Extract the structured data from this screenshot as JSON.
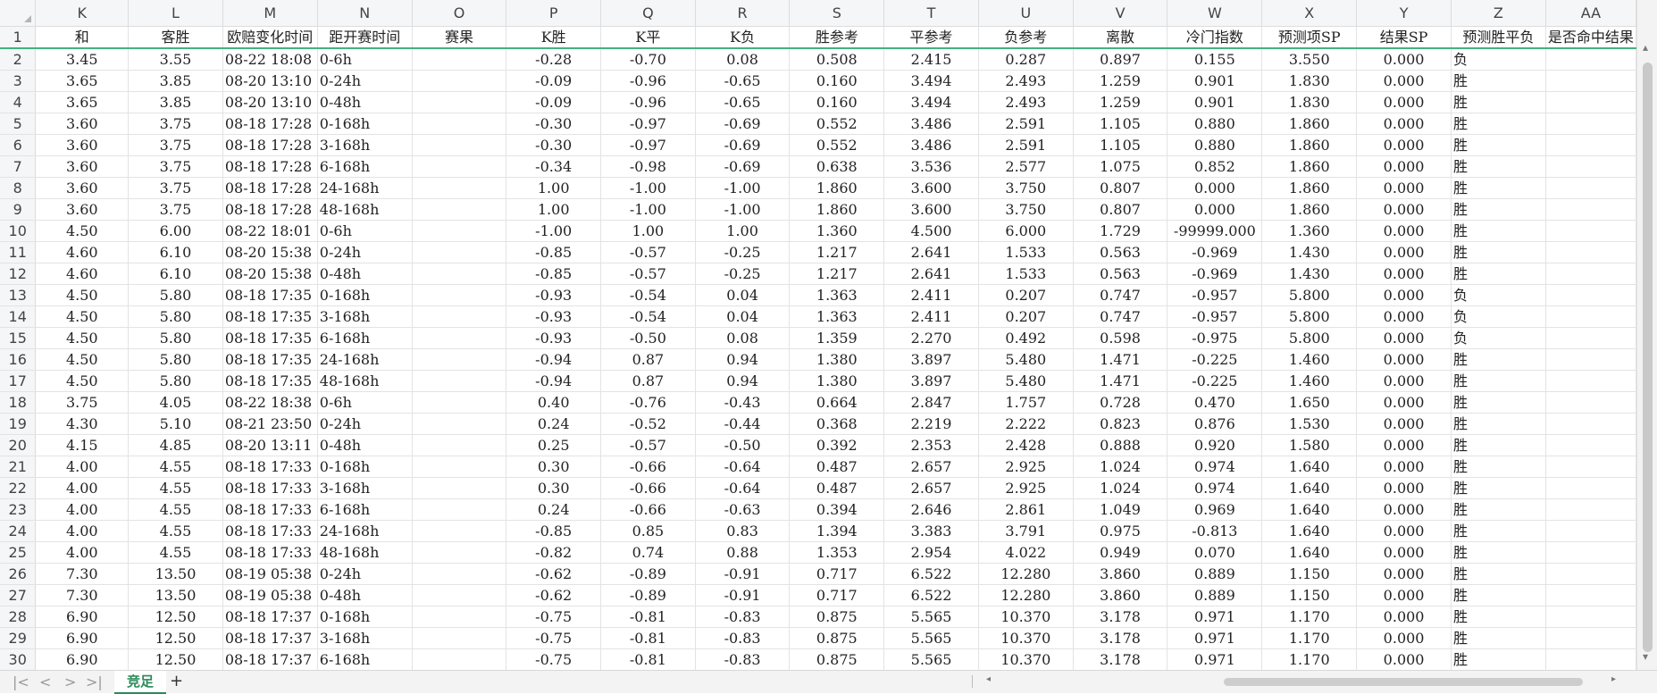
{
  "sheet": {
    "tab_label": "竞足",
    "columns": [
      "K",
      "L",
      "M",
      "N",
      "O",
      "P",
      "Q",
      "R",
      "S",
      "T",
      "U",
      "V",
      "W",
      "X",
      "Y",
      "Z",
      "AA"
    ],
    "header_row": [
      "和",
      "客胜",
      "欧赔变化时间",
      "距开赛时间",
      "赛果",
      "K胜",
      "K平",
      "K负",
      "胜参考",
      "平参考",
      "负参考",
      "离散",
      "冷门指数",
      "预测项SP",
      "结果SP",
      "预测胜平负",
      "是否命中结果"
    ],
    "rows": [
      [
        "2",
        "3.45",
        "3.55",
        "08-22 18:08",
        "0-6h",
        "",
        "-0.28",
        "-0.70",
        "0.08",
        "0.508",
        "2.415",
        "0.287",
        "0.897",
        "0.155",
        "3.550",
        "0.000",
        "负",
        ""
      ],
      [
        "3",
        "3.65",
        "3.85",
        "08-20 13:10",
        "0-24h",
        "",
        "-0.09",
        "-0.96",
        "-0.65",
        "0.160",
        "3.494",
        "2.493",
        "1.259",
        "0.901",
        "1.830",
        "0.000",
        "胜",
        ""
      ],
      [
        "4",
        "3.65",
        "3.85",
        "08-20 13:10",
        "0-48h",
        "",
        "-0.09",
        "-0.96",
        "-0.65",
        "0.160",
        "3.494",
        "2.493",
        "1.259",
        "0.901",
        "1.830",
        "0.000",
        "胜",
        ""
      ],
      [
        "5",
        "3.60",
        "3.75",
        "08-18 17:28",
        "0-168h",
        "",
        "-0.30",
        "-0.97",
        "-0.69",
        "0.552",
        "3.486",
        "2.591",
        "1.105",
        "0.880",
        "1.860",
        "0.000",
        "胜",
        ""
      ],
      [
        "6",
        "3.60",
        "3.75",
        "08-18 17:28",
        "3-168h",
        "",
        "-0.30",
        "-0.97",
        "-0.69",
        "0.552",
        "3.486",
        "2.591",
        "1.105",
        "0.880",
        "1.860",
        "0.000",
        "胜",
        ""
      ],
      [
        "7",
        "3.60",
        "3.75",
        "08-18 17:28",
        "6-168h",
        "",
        "-0.34",
        "-0.98",
        "-0.69",
        "0.638",
        "3.536",
        "2.577",
        "1.075",
        "0.852",
        "1.860",
        "0.000",
        "胜",
        ""
      ],
      [
        "8",
        "3.60",
        "3.75",
        "08-18 17:28",
        "24-168h",
        "",
        "1.00",
        "-1.00",
        "-1.00",
        "1.860",
        "3.600",
        "3.750",
        "0.807",
        "0.000",
        "1.860",
        "0.000",
        "胜",
        ""
      ],
      [
        "9",
        "3.60",
        "3.75",
        "08-18 17:28",
        "48-168h",
        "",
        "1.00",
        "-1.00",
        "-1.00",
        "1.860",
        "3.600",
        "3.750",
        "0.807",
        "0.000",
        "1.860",
        "0.000",
        "胜",
        ""
      ],
      [
        "10",
        "4.50",
        "6.00",
        "08-22 18:01",
        "0-6h",
        "",
        "-1.00",
        "1.00",
        "1.00",
        "1.360",
        "4.500",
        "6.000",
        "1.729",
        "-99999.000",
        "1.360",
        "0.000",
        "胜",
        ""
      ],
      [
        "11",
        "4.60",
        "6.10",
        "08-20 15:38",
        "0-24h",
        "",
        "-0.85",
        "-0.57",
        "-0.25",
        "1.217",
        "2.641",
        "1.533",
        "0.563",
        "-0.969",
        "1.430",
        "0.000",
        "胜",
        ""
      ],
      [
        "12",
        "4.60",
        "6.10",
        "08-20 15:38",
        "0-48h",
        "",
        "-0.85",
        "-0.57",
        "-0.25",
        "1.217",
        "2.641",
        "1.533",
        "0.563",
        "-0.969",
        "1.430",
        "0.000",
        "胜",
        ""
      ],
      [
        "13",
        "4.50",
        "5.80",
        "08-18 17:35",
        "0-168h",
        "",
        "-0.93",
        "-0.54",
        "0.04",
        "1.363",
        "2.411",
        "0.207",
        "0.747",
        "-0.957",
        "5.800",
        "0.000",
        "负",
        ""
      ],
      [
        "14",
        "4.50",
        "5.80",
        "08-18 17:35",
        "3-168h",
        "",
        "-0.93",
        "-0.54",
        "0.04",
        "1.363",
        "2.411",
        "0.207",
        "0.747",
        "-0.957",
        "5.800",
        "0.000",
        "负",
        ""
      ],
      [
        "15",
        "4.50",
        "5.80",
        "08-18 17:35",
        "6-168h",
        "",
        "-0.93",
        "-0.50",
        "0.08",
        "1.359",
        "2.270",
        "0.492",
        "0.598",
        "-0.975",
        "5.800",
        "0.000",
        "负",
        ""
      ],
      [
        "16",
        "4.50",
        "5.80",
        "08-18 17:35",
        "24-168h",
        "",
        "-0.94",
        "0.87",
        "0.94",
        "1.380",
        "3.897",
        "5.480",
        "1.471",
        "-0.225",
        "1.460",
        "0.000",
        "胜",
        ""
      ],
      [
        "17",
        "4.50",
        "5.80",
        "08-18 17:35",
        "48-168h",
        "",
        "-0.94",
        "0.87",
        "0.94",
        "1.380",
        "3.897",
        "5.480",
        "1.471",
        "-0.225",
        "1.460",
        "0.000",
        "胜",
        ""
      ],
      [
        "18",
        "3.75",
        "4.05",
        "08-22 18:38",
        "0-6h",
        "",
        "0.40",
        "-0.76",
        "-0.43",
        "0.664",
        "2.847",
        "1.757",
        "0.728",
        "0.470",
        "1.650",
        "0.000",
        "胜",
        ""
      ],
      [
        "19",
        "4.30",
        "5.10",
        "08-21 23:50",
        "0-24h",
        "",
        "0.24",
        "-0.52",
        "-0.44",
        "0.368",
        "2.219",
        "2.222",
        "0.823",
        "0.876",
        "1.530",
        "0.000",
        "胜",
        ""
      ],
      [
        "20",
        "4.15",
        "4.85",
        "08-20 13:11",
        "0-48h",
        "",
        "0.25",
        "-0.57",
        "-0.50",
        "0.392",
        "2.353",
        "2.428",
        "0.888",
        "0.920",
        "1.580",
        "0.000",
        "胜",
        ""
      ],
      [
        "21",
        "4.00",
        "4.55",
        "08-18 17:33",
        "0-168h",
        "",
        "0.30",
        "-0.66",
        "-0.64",
        "0.487",
        "2.657",
        "2.925",
        "1.024",
        "0.974",
        "1.640",
        "0.000",
        "胜",
        ""
      ],
      [
        "22",
        "4.00",
        "4.55",
        "08-18 17:33",
        "3-168h",
        "",
        "0.30",
        "-0.66",
        "-0.64",
        "0.487",
        "2.657",
        "2.925",
        "1.024",
        "0.974",
        "1.640",
        "0.000",
        "胜",
        ""
      ],
      [
        "23",
        "4.00",
        "4.55",
        "08-18 17:33",
        "6-168h",
        "",
        "0.24",
        "-0.66",
        "-0.63",
        "0.394",
        "2.646",
        "2.861",
        "1.049",
        "0.969",
        "1.640",
        "0.000",
        "胜",
        ""
      ],
      [
        "24",
        "4.00",
        "4.55",
        "08-18 17:33",
        "24-168h",
        "",
        "-0.85",
        "0.85",
        "0.83",
        "1.394",
        "3.383",
        "3.791",
        "0.975",
        "-0.813",
        "1.640",
        "0.000",
        "胜",
        ""
      ],
      [
        "25",
        "4.00",
        "4.55",
        "08-18 17:33",
        "48-168h",
        "",
        "-0.82",
        "0.74",
        "0.88",
        "1.353",
        "2.954",
        "4.022",
        "0.949",
        "0.070",
        "1.640",
        "0.000",
        "胜",
        ""
      ],
      [
        "26",
        "7.30",
        "13.50",
        "08-19 05:38",
        "0-24h",
        "",
        "-0.62",
        "-0.89",
        "-0.91",
        "0.717",
        "6.522",
        "12.280",
        "3.860",
        "0.889",
        "1.150",
        "0.000",
        "胜",
        ""
      ],
      [
        "27",
        "7.30",
        "13.50",
        "08-19 05:38",
        "0-48h",
        "",
        "-0.62",
        "-0.89",
        "-0.91",
        "0.717",
        "6.522",
        "12.280",
        "3.860",
        "0.889",
        "1.150",
        "0.000",
        "胜",
        ""
      ],
      [
        "28",
        "6.90",
        "12.50",
        "08-18 17:37",
        "0-168h",
        "",
        "-0.75",
        "-0.81",
        "-0.83",
        "0.875",
        "5.565",
        "10.370",
        "3.178",
        "0.971",
        "1.170",
        "0.000",
        "胜",
        ""
      ],
      [
        "29",
        "6.90",
        "12.50",
        "08-18 17:37",
        "3-168h",
        "",
        "-0.75",
        "-0.81",
        "-0.83",
        "0.875",
        "5.565",
        "10.370",
        "3.178",
        "0.971",
        "1.170",
        "0.000",
        "胜",
        ""
      ],
      [
        "30",
        "6.90",
        "12.50",
        "08-18 17:37",
        "6-168h",
        "",
        "-0.75",
        "-0.81",
        "-0.83",
        "0.875",
        "5.565",
        "10.370",
        "3.178",
        "0.971",
        "1.170",
        "0.000",
        "胜",
        ""
      ]
    ]
  },
  "colors": {
    "accent": "#2a8a57",
    "freeze_line": "#3fb37f",
    "header_bg": "#f5f6f7"
  },
  "icons": [
    "first-sheet-icon",
    "prev-sheet-icon",
    "next-sheet-icon",
    "last-sheet-icon",
    "add-sheet-icon",
    "scroll-left-icon",
    "scroll-right-icon",
    "scroll-up-icon",
    "scroll-down-icon"
  ]
}
